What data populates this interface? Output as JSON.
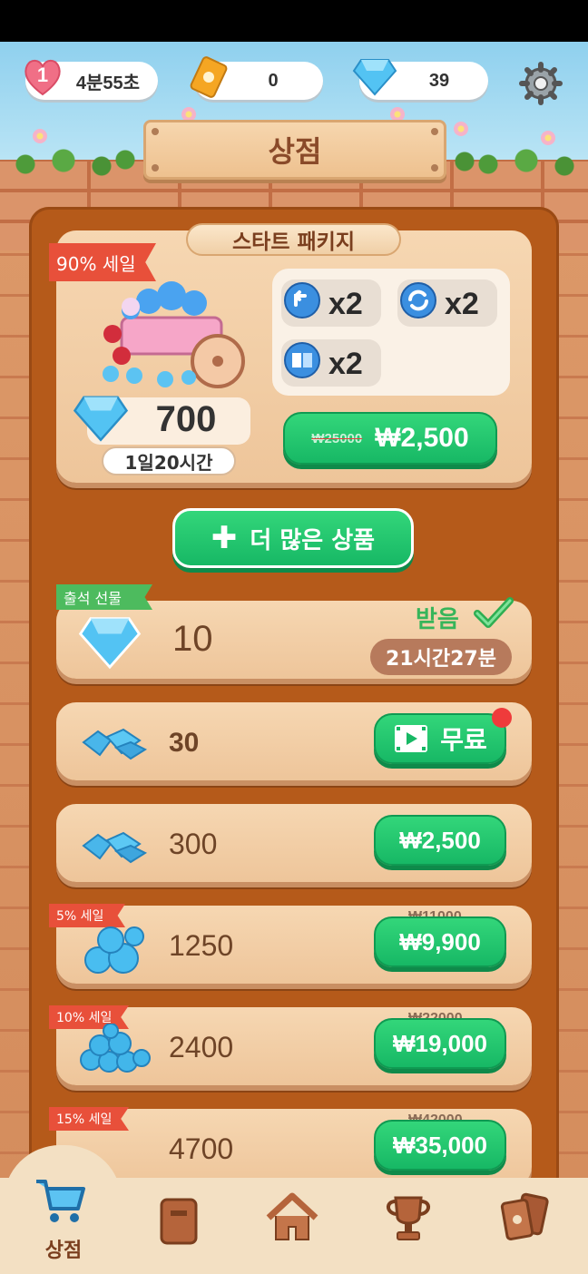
{
  "topbar": {
    "lives_count": "1",
    "lives_timer": "4분55초",
    "cards_count": "0",
    "gems_count": "39"
  },
  "header": {
    "title": "상점"
  },
  "starter_package": {
    "label": "스타트 패키지",
    "sale_badge": "90% 세일",
    "gems": "700",
    "time_left": "1일20시간",
    "boosters": [
      {
        "icon": "undo-booster-icon",
        "count": "x2"
      },
      {
        "icon": "shuffle-booster-icon",
        "count": "x2"
      },
      {
        "icon": "hint-booster-icon",
        "count": "x2"
      }
    ],
    "old_price": "₩25000",
    "price": "₩2,500"
  },
  "more_button": {
    "label": "더 많은 상품"
  },
  "daily_gift": {
    "badge": "출석 선물",
    "amount": "10",
    "status": "받음",
    "timer": "21시간27분"
  },
  "products": [
    {
      "amount": "30",
      "button": "무료",
      "badge": "",
      "old_price": ""
    },
    {
      "amount": "300",
      "button": "₩2,500",
      "badge": "",
      "old_price": ""
    },
    {
      "amount": "1250",
      "button": "₩9,900",
      "badge": "5% 세일",
      "old_price": "₩11000"
    },
    {
      "amount": "2400",
      "button": "₩19,000",
      "badge": "10% 세일",
      "old_price": "₩22000"
    },
    {
      "amount": "4700",
      "button": "₩35,000",
      "badge": "15% 세일",
      "old_price": "₩42000"
    }
  ],
  "bottom_nav": {
    "active_label": "상점",
    "items": [
      "shop-cart-icon",
      "collection-book-icon",
      "home-icon",
      "trophy-icon",
      "cards-icon"
    ]
  },
  "colors": {
    "accent_green": "#17b865",
    "panel_brown": "#b55a1a",
    "sale_red": "#e8503a",
    "gem_blue": "#3aa7e8"
  }
}
